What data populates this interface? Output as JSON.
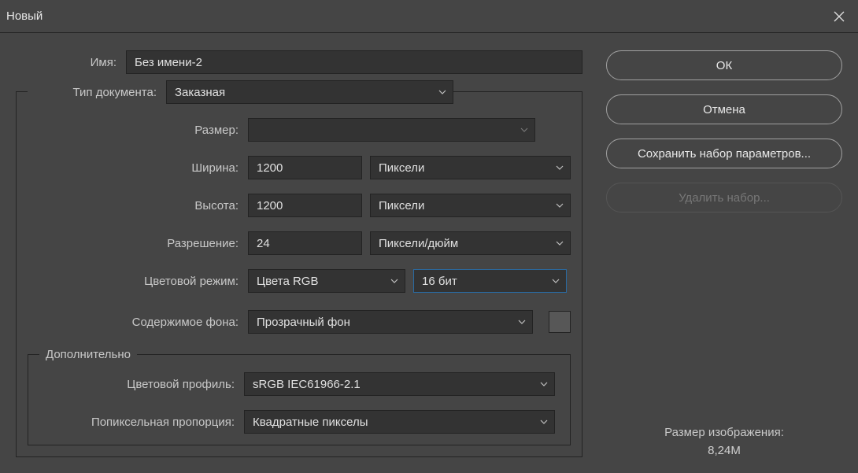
{
  "titlebar": {
    "title": "Новый"
  },
  "name_row": {
    "label": "Имя:",
    "value": "Без имени-2"
  },
  "doc_type": {
    "label": "Тип документа:",
    "value": "Заказная"
  },
  "size": {
    "label": "Размер:",
    "value": ""
  },
  "width": {
    "label": "Ширина:",
    "value": "1200",
    "unit": "Пиксели"
  },
  "height": {
    "label": "Высота:",
    "value": "1200",
    "unit": "Пиксели"
  },
  "resolution": {
    "label": "Разрешение:",
    "value": "24",
    "unit": "Пиксели/дюйм"
  },
  "color_mode": {
    "label": "Цветовой режим:",
    "value": "Цвета RGB",
    "depth": "16 бит"
  },
  "bg_content": {
    "label": "Содержимое фона:",
    "value": "Прозрачный фон"
  },
  "advanced": {
    "legend": "Дополнительно",
    "profile": {
      "label": "Цветовой профиль:",
      "value": "sRGB IEC61966-2.1"
    },
    "pixel_aspect": {
      "label": "Попиксельная пропорция:",
      "value": "Квадратные пикселы"
    }
  },
  "buttons": {
    "ok": "ОК",
    "cancel": "Отмена",
    "save_preset": "Сохранить набор параметров...",
    "delete_preset": "Удалить набор..."
  },
  "image_size": {
    "label": "Размер изображения:",
    "value": "8,24M"
  }
}
